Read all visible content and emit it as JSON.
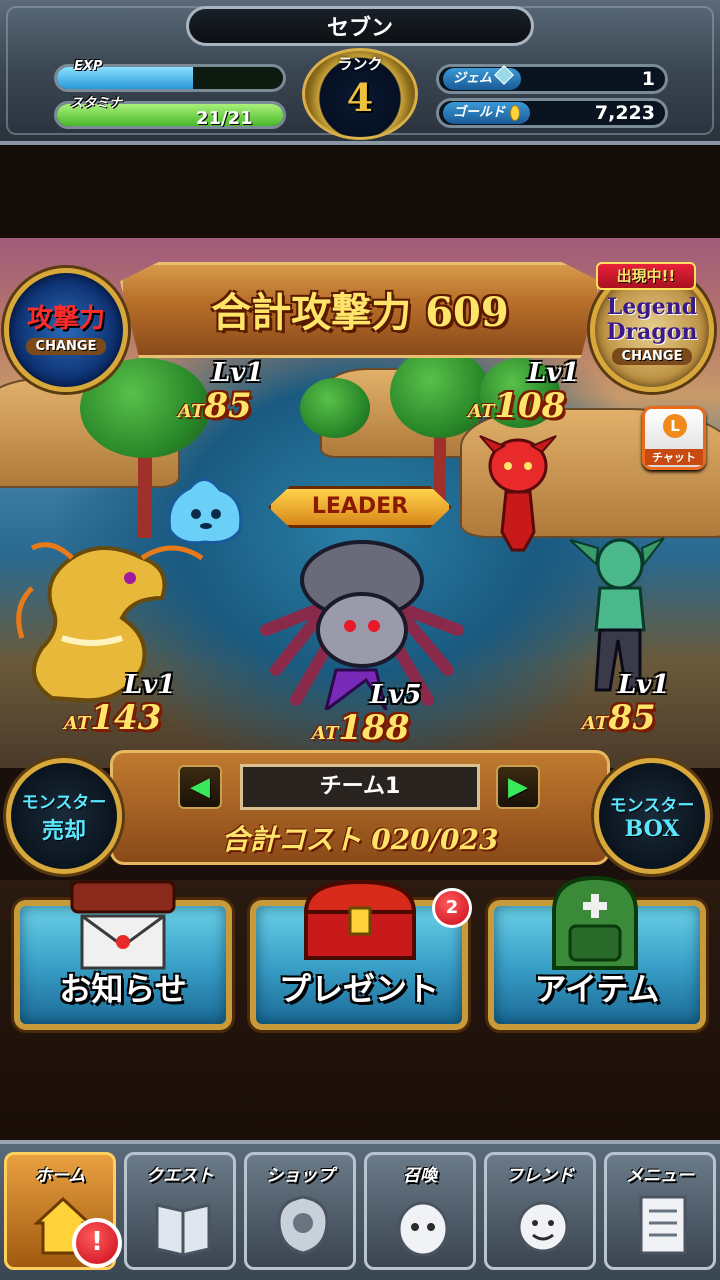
{
  "header": {
    "player_name": "セブン",
    "rank_label": "ランク",
    "rank_value": "4",
    "exp_label": "EXP",
    "exp_fill": 0.6,
    "stamina_label": "スタミナ",
    "stamina_value": "21/21",
    "stamina_fill": 1.0,
    "gem_label": "ジェム",
    "gem_value": "1",
    "gold_label": "ゴールド",
    "gold_value": "7,223"
  },
  "battle": {
    "total_power": "合計攻撃力 609",
    "attack_change": {
      "main": "攻撃力",
      "sub": "CHANGE"
    },
    "legend_change": {
      "tag": "出現中!!",
      "main": "Legend Dragon",
      "sub": "CHANGE"
    },
    "chat_label": "チャット",
    "chat_badge": "L",
    "leader_label": "LEADER",
    "at_prefix": "AT",
    "monsters": [
      {
        "name": "blue-slime",
        "lv": "Lv1",
        "at": "85"
      },
      {
        "name": "red-imp",
        "lv": "Lv1",
        "at": "108"
      },
      {
        "name": "gold-dragon",
        "lv": "Lv1",
        "at": "143"
      },
      {
        "name": "spider-leader",
        "lv": "Lv5",
        "at": "188"
      },
      {
        "name": "green-goblin",
        "lv": "Lv1",
        "at": "85"
      }
    ]
  },
  "team": {
    "name": "チーム1",
    "cost": "合計コスト 020/023",
    "sell": {
      "line1": "モンスター",
      "line2": "売却"
    },
    "box": {
      "line1": "モンスター",
      "line2": "BOX"
    }
  },
  "actions": {
    "news": "お知らせ",
    "present": "プレゼント",
    "present_badge": "2",
    "item": "アイテム"
  },
  "nav": {
    "home": "ホーム",
    "quest": "クエスト",
    "shop": "ショップ",
    "summon": "召喚",
    "friend": "フレンド",
    "menu": "メニュー",
    "home_alert": "!"
  },
  "colors": {
    "accent_gold": "#ffe46a",
    "exp_bar": "#3ab8e8",
    "stamina_bar": "#6ad83a"
  }
}
